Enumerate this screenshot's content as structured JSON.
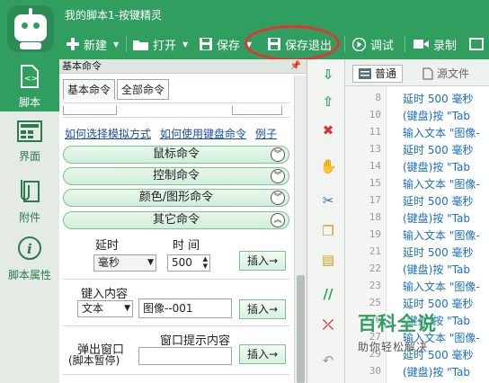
{
  "app": {
    "title": "我的脚本1-按键精灵"
  },
  "toolbar": {
    "new": "新建",
    "open": "打开",
    "save": "保存",
    "save_exit": "保存退出",
    "debug": "调试",
    "record": "录制"
  },
  "sidebar": [
    {
      "label": "脚本",
      "icon": "script-icon"
    },
    {
      "label": "界面",
      "icon": "interface-icon"
    },
    {
      "label": "附件",
      "icon": "attachment-icon"
    },
    {
      "label": "脚本属性",
      "icon": "info-icon"
    }
  ],
  "panel": {
    "title": "基本命令",
    "tabs": [
      "基本命令",
      "全部命令"
    ],
    "links": [
      "如何选择模拟方式",
      "如何使用键盘命令",
      "例子"
    ],
    "categories": [
      "鼠标命令",
      "控制命令",
      "颜色/图形命令",
      "其它命令"
    ],
    "delay": {
      "label": "延时",
      "time_label": "时 间",
      "unit": "毫秒",
      "value": "500",
      "insert": "插入→"
    },
    "keyinput": {
      "label": "键入内容",
      "type": "文本",
      "value": "图像--001",
      "insert": "插入→"
    },
    "popup": {
      "label1": "弹出窗口",
      "label2": "(脚本暂停)",
      "content_label": "窗口提示内容",
      "insert": "插入→"
    }
  },
  "editor": {
    "tabs": [
      "普通",
      "源文件"
    ],
    "lines": [
      {
        "n": "8",
        "t": "延时 500 毫秒"
      },
      {
        "n": "10",
        "t": "(键盘)按 \"Tab"
      },
      {
        "n": "11",
        "t": "输入文本 \"图像-"
      },
      {
        "n": "13",
        "t": "延时 500 毫秒"
      },
      {
        "n": "14",
        "t": "(键盘)按 \"Tab"
      },
      {
        "n": "15",
        "t": "输入文本 \"图像-"
      },
      {
        "n": "17",
        "t": "延时 500 毫秒"
      },
      {
        "n": "18",
        "t": "(键盘)按 \"Tab"
      },
      {
        "n": "19",
        "t": "输入文本 \"图像-"
      },
      {
        "n": "21",
        "t": "延时 500 毫秒"
      },
      {
        "n": "22",
        "t": "(键盘)按 \"Tab"
      },
      {
        "n": "23",
        "t": "输入文本 \"图像-"
      },
      {
        "n": "25",
        "t": "延时 500 毫秒"
      },
      {
        "n": "26",
        "t": "(键盘)按 \"Tab"
      },
      {
        "n": "27",
        "t": "输入文本 \"图像-"
      },
      {
        "n": "29",
        "t": "延时 500 毫秒"
      },
      {
        "n": "30",
        "t": "(键盘)按 \"Tab"
      }
    ]
  },
  "watermark": {
    "title": "百科全说",
    "subtitle": "助你轻松解决"
  },
  "colors": {
    "primary": "#2f9e5f",
    "highlight": "#e63232",
    "code": "#1a6fbf"
  }
}
